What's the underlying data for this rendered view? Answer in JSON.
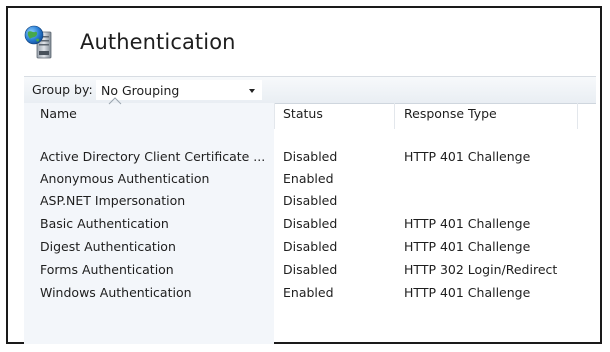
{
  "page": {
    "title": "Authentication",
    "icon": "server-globe-icon"
  },
  "group_by": {
    "label": "Group by:",
    "value": "No Grouping"
  },
  "columns": {
    "name": "Name",
    "status": "Status",
    "response_type": "Response Type"
  },
  "rows": [
    {
      "name": "Active Directory Client Certificate ...",
      "status": "Disabled",
      "response_type": "HTTP 401 Challenge"
    },
    {
      "name": "Anonymous Authentication",
      "status": "Enabled",
      "response_type": ""
    },
    {
      "name": "ASP.NET Impersonation",
      "status": "Disabled",
      "response_type": ""
    },
    {
      "name": "Basic Authentication",
      "status": "Disabled",
      "response_type": "HTTP 401 Challenge"
    },
    {
      "name": "Digest Authentication",
      "status": "Disabled",
      "response_type": "HTTP 401 Challenge"
    },
    {
      "name": "Forms Authentication",
      "status": "Disabled",
      "response_type": "HTTP 302 Login/Redirect"
    },
    {
      "name": "Windows Authentication",
      "status": "Enabled",
      "response_type": "HTTP 401 Challenge"
    }
  ],
  "colors": {
    "groupbar_top": "#f7f9fb",
    "groupbar_bottom": "#e9eef3",
    "name_column_bg": "#f3f6fa",
    "frame_border": "#1a1a1a"
  }
}
